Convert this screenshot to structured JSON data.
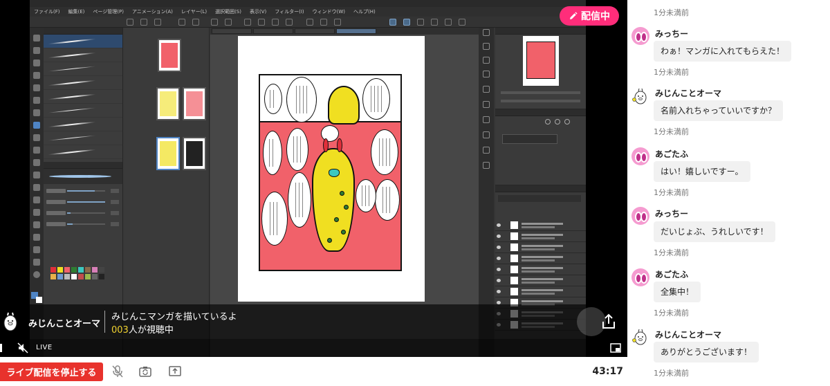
{
  "live_badge": {
    "icon": "pencil-icon",
    "label": "配信中",
    "color": "#ff2d7a"
  },
  "app": {
    "menu": [
      "ファイル(F)",
      "編集(E)",
      "ページ管理(P)",
      "アニメーション(A)",
      "レイヤー(L)",
      "選択範囲(S)",
      "表示(V)",
      "フィルター(I)",
      "ウィンドウ(W)",
      "ヘルプ(H)"
    ]
  },
  "stream_info": {
    "streamer_name": "みじんことオーマ",
    "title": "みじんこマンガを描いているよ",
    "viewer_count": "003",
    "viewer_suffix": "人が視聴中",
    "live_label": "LIVE"
  },
  "bottom_bar": {
    "stop_button": "ライブ配信を停止する",
    "timer": "43:17",
    "stop_color": "#e8322c"
  },
  "chat": {
    "top_time": "1分未満前",
    "messages": [
      {
        "name": "みっちー",
        "avatar": "pink-face-icon",
        "text": "わぁ！マンガに入れてもらえた！",
        "time": "1分未満前"
      },
      {
        "name": "みじんことオーマ",
        "avatar": "chick-character-icon",
        "text": "名前入れちゃっていいですか？",
        "time": "1分未満前"
      },
      {
        "name": "あごたふ",
        "avatar": "pink-face-icon",
        "text": "はい！嬉しいですー。",
        "time": "1分未満前"
      },
      {
        "name": "みっちー",
        "avatar": "pink-face-icon",
        "text": "だいじょぶ、うれしいです！",
        "time": "1分未満前"
      },
      {
        "name": "あごたふ",
        "avatar": "pink-face-icon",
        "text": "全集中！",
        "time": "1分未満前"
      },
      {
        "name": "みじんことオーマ",
        "avatar": "chick-character-icon",
        "text": "ありがとうございます！",
        "time": "1分未満前"
      }
    ]
  }
}
